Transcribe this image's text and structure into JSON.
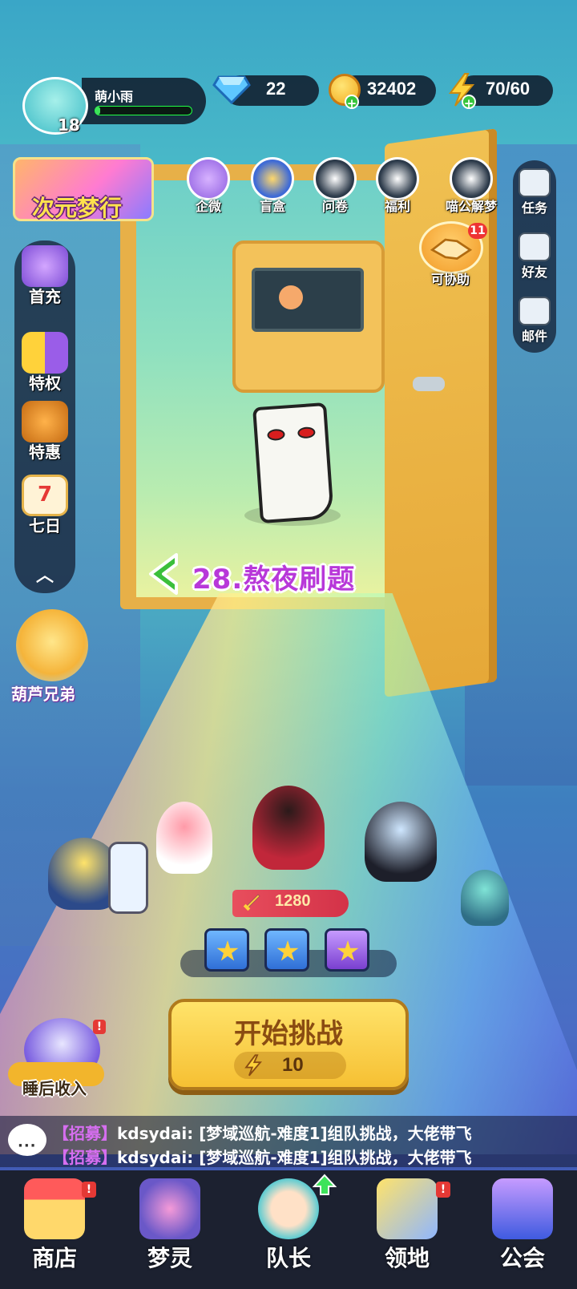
{
  "player": {
    "name": "萌小雨",
    "level": "18",
    "exp_progress": 0.05
  },
  "resources": {
    "gems": "22",
    "gold": "32402",
    "energy": "70/60"
  },
  "event_banner": {
    "label": "次元梦行"
  },
  "top_icons": [
    {
      "label": "企微",
      "icon": "gift-icon"
    },
    {
      "label": "盲盒",
      "icon": "mystery-box-icon"
    },
    {
      "label": "问卷",
      "icon": "survey-icon"
    },
    {
      "label": "福利",
      "icon": "welfare-gift-icon"
    },
    {
      "label": "喵公解梦",
      "icon": "cat-dream-icon"
    }
  ],
  "right_panel": [
    {
      "label": "任务",
      "icon": "task-icon"
    },
    {
      "label": "好友",
      "icon": "friends-icon"
    },
    {
      "label": "邮件",
      "icon": "mail-icon"
    }
  ],
  "assist": {
    "label": "可协助",
    "count": "11"
  },
  "left_panel": [
    {
      "label": "首充",
      "icon": "first-charge-icon"
    },
    {
      "label": "特权",
      "icon": "privilege-card-icon"
    },
    {
      "label": "特惠",
      "icon": "special-offer-icon"
    },
    {
      "label": "七日",
      "icon": "calendar-icon",
      "date": "7"
    }
  ],
  "gourd": {
    "label": "葫芦兄弟"
  },
  "level": {
    "title": "28.熬夜刷题"
  },
  "team": {
    "power": "1280"
  },
  "start_button": {
    "label": "开始挑战",
    "cost": "10"
  },
  "sleep_income": {
    "label": "睡后收入",
    "badge": "!"
  },
  "chat": [
    {
      "tag": "【招募】",
      "text": "kdsydai: [梦域巡航-难度1]组队挑战，大佬带飞"
    },
    {
      "tag": "【招募】",
      "text": "kdsydai: [梦域巡航-难度1]组队挑战，大佬带飞"
    }
  ],
  "bottom_nav": [
    {
      "label": "商店",
      "icon": "shop-icon",
      "badge": "!"
    },
    {
      "label": "梦灵",
      "icon": "dream-spirit-icon",
      "badge": ""
    },
    {
      "label": "队长",
      "icon": "captain-icon",
      "badge": ""
    },
    {
      "label": "领地",
      "icon": "territory-icon",
      "badge": "!"
    },
    {
      "label": "公会",
      "icon": "guild-icon",
      "badge": ""
    }
  ],
  "colors": {
    "level_title": "#b838d9",
    "start_button": "#f6c033",
    "exp_bar": "#3de35a",
    "badge_red": "#e53935"
  }
}
